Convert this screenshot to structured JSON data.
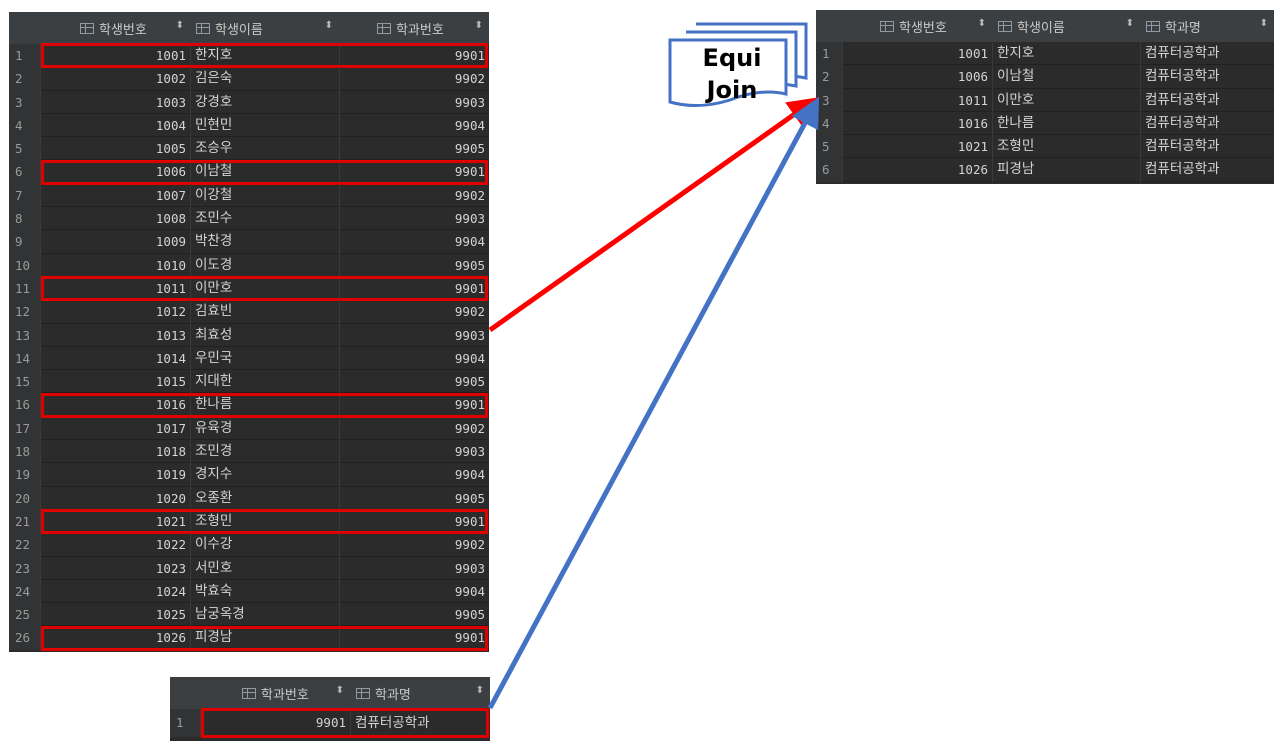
{
  "students": {
    "columns": [
      "학생번호",
      "학생이름",
      "학과번호"
    ],
    "rows": [
      [
        "1",
        "1001",
        "한지호",
        "9901"
      ],
      [
        "2",
        "1002",
        "김은숙",
        "9902"
      ],
      [
        "3",
        "1003",
        "강경호",
        "9903"
      ],
      [
        "4",
        "1004",
        "민현민",
        "9904"
      ],
      [
        "5",
        "1005",
        "조승우",
        "9905"
      ],
      [
        "6",
        "1006",
        "이남철",
        "9901"
      ],
      [
        "7",
        "1007",
        "이강철",
        "9902"
      ],
      [
        "8",
        "1008",
        "조민수",
        "9903"
      ],
      [
        "9",
        "1009",
        "박찬경",
        "9904"
      ],
      [
        "10",
        "1010",
        "이도경",
        "9905"
      ],
      [
        "11",
        "1011",
        "이만호",
        "9901"
      ],
      [
        "12",
        "1012",
        "김효빈",
        "9902"
      ],
      [
        "13",
        "1013",
        "최효성",
        "9903"
      ],
      [
        "14",
        "1014",
        "우민국",
        "9904"
      ],
      [
        "15",
        "1015",
        "지대한",
        "9905"
      ],
      [
        "16",
        "1016",
        "한나름",
        "9901"
      ],
      [
        "17",
        "1017",
        "유육경",
        "9902"
      ],
      [
        "18",
        "1018",
        "조민경",
        "9903"
      ],
      [
        "19",
        "1019",
        "경지수",
        "9904"
      ],
      [
        "20",
        "1020",
        "오종환",
        "9905"
      ],
      [
        "21",
        "1021",
        "조형민",
        "9901"
      ],
      [
        "22",
        "1022",
        "이수강",
        "9902"
      ],
      [
        "23",
        "1023",
        "서민호",
        "9903"
      ],
      [
        "24",
        "1024",
        "박효숙",
        "9904"
      ],
      [
        "25",
        "1025",
        "남궁옥경",
        "9905"
      ],
      [
        "26",
        "1026",
        "피경남",
        "9901"
      ]
    ],
    "highlighted_rows": [
      1,
      6,
      11,
      16,
      21,
      26
    ]
  },
  "departments": {
    "columns": [
      "학과번호",
      "학과명"
    ],
    "rows": [
      [
        "1",
        "9901",
        "컴퓨터공학과"
      ]
    ],
    "highlighted_rows": [
      1
    ]
  },
  "result": {
    "columns": [
      "학생번호",
      "학생이름",
      "학과명"
    ],
    "rows": [
      [
        "1",
        "1001",
        "한지호",
        "컴퓨터공학과"
      ],
      [
        "2",
        "1006",
        "이남철",
        "컴퓨터공학과"
      ],
      [
        "3",
        "1011",
        "이만호",
        "컴퓨터공학과"
      ],
      [
        "4",
        "1016",
        "한나름",
        "컴퓨터공학과"
      ],
      [
        "5",
        "1021",
        "조형민",
        "컴퓨터공학과"
      ],
      [
        "6",
        "1026",
        "피경남",
        "컴퓨터공학과"
      ]
    ]
  },
  "label": {
    "line1": "Equi",
    "line2": "Join"
  },
  "colors": {
    "highlight": "#e00000",
    "arrow_red": "#ff0000",
    "arrow_blue": "#4472c4",
    "grid_bg": "#2b2b2b"
  }
}
